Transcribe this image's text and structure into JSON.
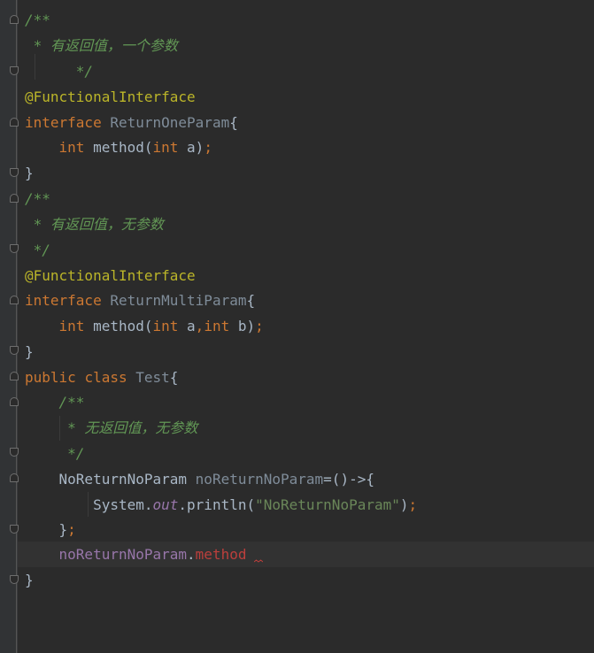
{
  "editor": {
    "colors": {
      "background": "#2b2b2b",
      "keyword": "#cc7832",
      "annotation": "#bbb529",
      "doc_comment": "#629755",
      "string": "#6a8759",
      "field": "#9876aa",
      "error": "#bc3f3c",
      "text": "#a9b7c6"
    },
    "lines": [
      {
        "tokens": [
          "/**"
        ]
      },
      {
        "tokens": [
          " * 有返回值，一个参数"
        ]
      },
      {
        "tokens": [
          "      */"
        ]
      },
      {
        "tokens": [
          "@FunctionalInterface"
        ]
      },
      {
        "tokens": [
          "interface",
          " ",
          "ReturnOneParam",
          "{"
        ]
      },
      {
        "tokens": [
          "    ",
          "int",
          " method(",
          "int",
          " a)",
          ";"
        ]
      },
      {
        "tokens": [
          "}"
        ]
      },
      {
        "tokens": [
          "/**"
        ]
      },
      {
        "tokens": [
          " * 有返回值，无参数"
        ]
      },
      {
        "tokens": [
          " */"
        ]
      },
      {
        "tokens": [
          "@FunctionalInterface"
        ]
      },
      {
        "tokens": [
          "interface",
          " ",
          "ReturnMultiParam",
          "{"
        ]
      },
      {
        "tokens": [
          "    ",
          "int",
          " method(",
          "int",
          " a",
          ",",
          "int",
          " b)",
          ";"
        ]
      },
      {
        "tokens": [
          "}"
        ]
      },
      {
        "tokens": [
          "public",
          " ",
          "class",
          " ",
          "Test",
          "{"
        ]
      },
      {
        "tokens": [
          "    ",
          "/**"
        ]
      },
      {
        "tokens": [
          "     * 无返回值，无参数"
        ]
      },
      {
        "tokens": [
          "     */"
        ]
      },
      {
        "tokens": [
          "    ",
          "NoReturnNoParam",
          " ",
          "noReturnNoParam",
          "=()->{"
        ]
      },
      {
        "tokens": [
          "        ",
          "System.",
          "out",
          ".println(",
          "\"NoReturnNoParam\"",
          ")",
          ";"
        ]
      },
      {
        "tokens": [
          "    ",
          "}",
          ";"
        ]
      },
      {
        "tokens": [
          "    ",
          "noReturnNoParam",
          ".",
          "method"
        ]
      },
      {
        "tokens": [
          "}"
        ]
      }
    ]
  }
}
